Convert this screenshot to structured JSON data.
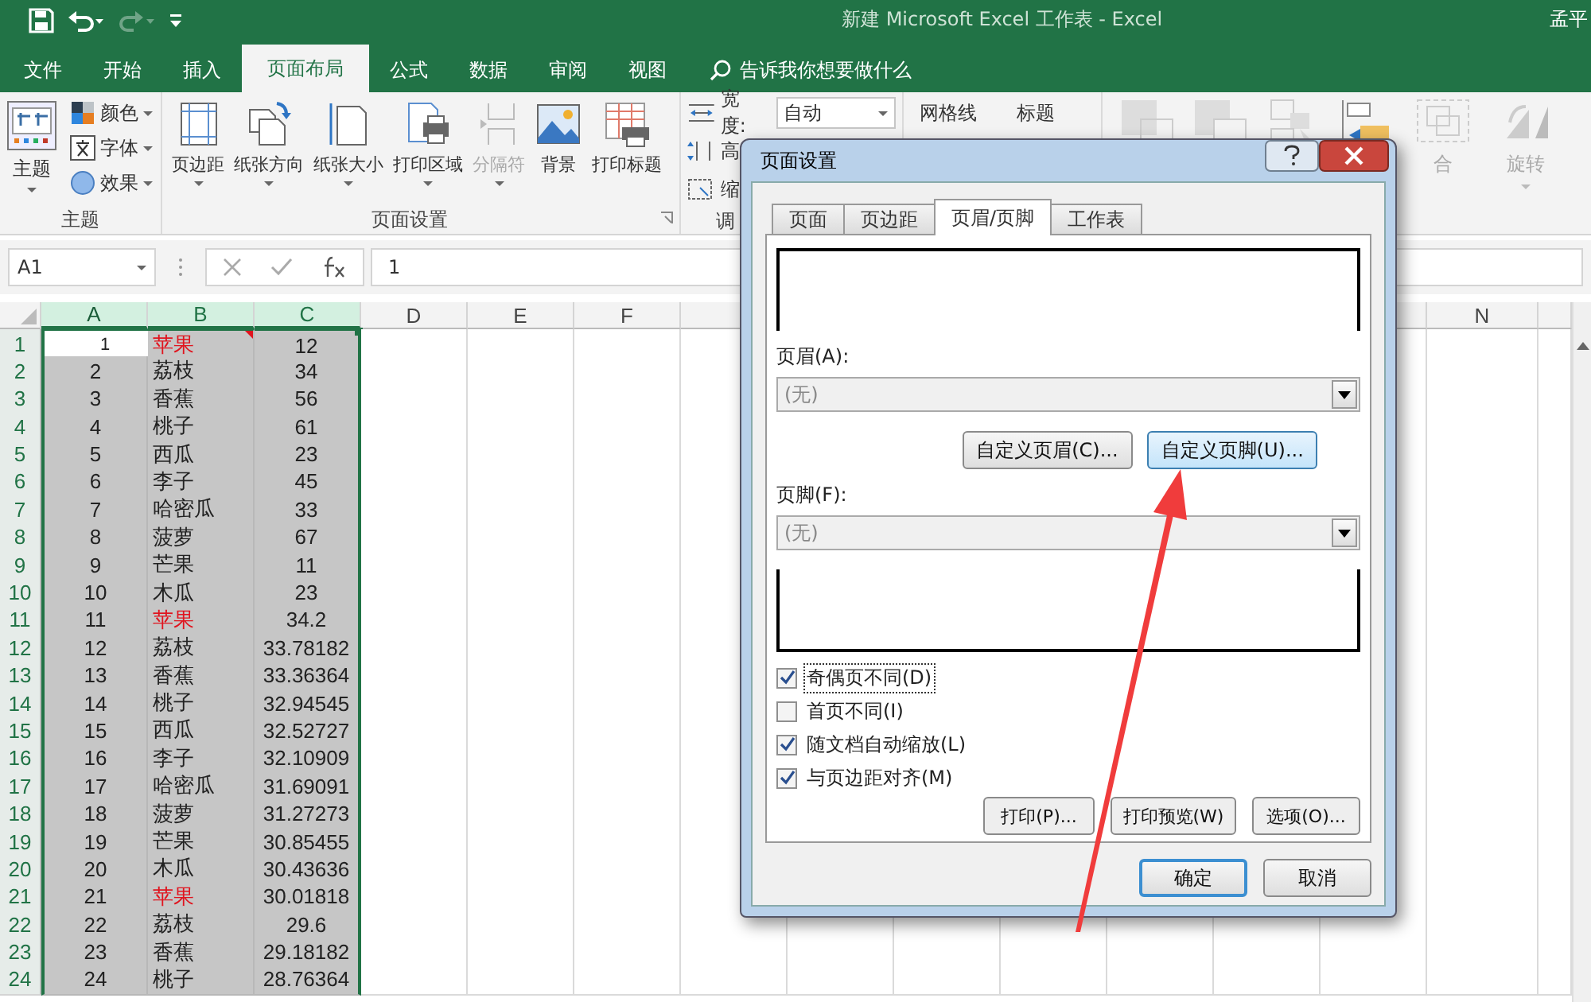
{
  "window": {
    "title": "新建 Microsoft Excel 工作表  -  Excel",
    "user": "孟平",
    "redo_disabled": true
  },
  "tabs": [
    {
      "label": "文件",
      "selected": false
    },
    {
      "label": "开始",
      "selected": false
    },
    {
      "label": "插入",
      "selected": false
    },
    {
      "label": "页面布局",
      "selected": true
    },
    {
      "label": "公式",
      "selected": false
    },
    {
      "label": "数据",
      "selected": false
    },
    {
      "label": "审阅",
      "selected": false
    },
    {
      "label": "视图",
      "selected": false
    }
  ],
  "tell_me": {
    "placeholder": "告诉我你想要做什么"
  },
  "ribbon": {
    "theme_group": {
      "label": "主题",
      "main": {
        "label": "主题",
        "has_menu": true
      },
      "items": [
        {
          "label": "颜色",
          "has_menu": true
        },
        {
          "label": "字体",
          "has_menu": true
        },
        {
          "label": "效果",
          "has_menu": true
        }
      ]
    },
    "page_setup_group": {
      "label": "页面设置",
      "buttons": [
        {
          "label": "页边距",
          "has_menu": true,
          "disabled": false
        },
        {
          "label": "纸张方向",
          "has_menu": true,
          "disabled": false
        },
        {
          "label": "纸张大小",
          "has_menu": true,
          "disabled": false
        },
        {
          "label": "打印区域",
          "has_menu": true,
          "disabled": false
        },
        {
          "label": "分隔符",
          "has_menu": true,
          "disabled": true
        },
        {
          "label": "背景",
          "has_menu": false,
          "disabled": false
        },
        {
          "label": "打印标题",
          "has_menu": false,
          "disabled": false
        }
      ]
    },
    "scale_group": {
      "width_label": "宽度:",
      "width_value": "自动",
      "height_label": "高",
      "scale_label": "缩",
      "label": "调"
    },
    "sheet_options": {
      "gridlines_label": "网格线",
      "headings_label": "标题"
    },
    "arrange_group": {
      "partial_label": "合",
      "rotate_label": "旋转"
    }
  },
  "formula_bar": {
    "name_box": "A1",
    "value": "1"
  },
  "sheet": {
    "columns": [
      {
        "label": "A",
        "selected": true,
        "active": true
      },
      {
        "label": "B",
        "selected": true,
        "active": false
      },
      {
        "label": "C",
        "selected": true,
        "active": false
      },
      {
        "label": "D",
        "selected": false,
        "active": false
      },
      {
        "label": "E",
        "selected": false,
        "active": false
      },
      {
        "label": "F",
        "selected": false,
        "active": false
      }
    ],
    "far_column": "N",
    "rows": [
      {
        "number": "1",
        "selected": true,
        "active": true,
        "cells": [
          "1",
          "苹果",
          "12"
        ],
        "color": "#e0141e",
        "comment": true
      },
      {
        "number": "2",
        "selected": true,
        "active": false,
        "cells": [
          "2",
          "荔枝",
          "34"
        ],
        "color": "#222222",
        "comment": false
      },
      {
        "number": "3",
        "selected": true,
        "active": false,
        "cells": [
          "3",
          "香蕉",
          "56"
        ],
        "color": "#222222",
        "comment": false
      },
      {
        "number": "4",
        "selected": true,
        "active": false,
        "cells": [
          "4",
          "桃子",
          "61"
        ],
        "color": "#222222",
        "comment": false
      },
      {
        "number": "5",
        "selected": true,
        "active": false,
        "cells": [
          "5",
          "西瓜",
          "23"
        ],
        "color": "#222222",
        "comment": false
      },
      {
        "number": "6",
        "selected": true,
        "active": false,
        "cells": [
          "6",
          "李子",
          "45"
        ],
        "color": "#222222",
        "comment": false
      },
      {
        "number": "7",
        "selected": true,
        "active": false,
        "cells": [
          "7",
          "哈密瓜",
          "33"
        ],
        "color": "#222222",
        "comment": false
      },
      {
        "number": "8",
        "selected": true,
        "active": false,
        "cells": [
          "8",
          "菠萝",
          "67"
        ],
        "color": "#222222",
        "comment": false
      },
      {
        "number": "9",
        "selected": true,
        "active": false,
        "cells": [
          "9",
          "芒果",
          "11"
        ],
        "color": "#222222",
        "comment": false
      },
      {
        "number": "10",
        "selected": true,
        "active": false,
        "cells": [
          "10",
          "木瓜",
          "23"
        ],
        "color": "#222222",
        "comment": false
      },
      {
        "number": "11",
        "selected": true,
        "active": false,
        "cells": [
          "11",
          "苹果",
          "34.2"
        ],
        "color": "#e0141e",
        "comment": false
      },
      {
        "number": "12",
        "selected": true,
        "active": false,
        "cells": [
          "12",
          "荔枝",
          "33.78182"
        ],
        "color": "#222222",
        "comment": false
      },
      {
        "number": "13",
        "selected": true,
        "active": false,
        "cells": [
          "13",
          "香蕉",
          "33.36364"
        ],
        "color": "#222222",
        "comment": false
      },
      {
        "number": "14",
        "selected": true,
        "active": false,
        "cells": [
          "14",
          "桃子",
          "32.94545"
        ],
        "color": "#222222",
        "comment": false
      },
      {
        "number": "15",
        "selected": true,
        "active": false,
        "cells": [
          "15",
          "西瓜",
          "32.52727"
        ],
        "color": "#222222",
        "comment": false
      },
      {
        "number": "16",
        "selected": true,
        "active": false,
        "cells": [
          "16",
          "李子",
          "32.10909"
        ],
        "color": "#222222",
        "comment": false
      },
      {
        "number": "17",
        "selected": true,
        "active": false,
        "cells": [
          "17",
          "哈密瓜",
          "31.69091"
        ],
        "color": "#222222",
        "comment": false
      },
      {
        "number": "18",
        "selected": true,
        "active": false,
        "cells": [
          "18",
          "菠萝",
          "31.27273"
        ],
        "color": "#222222",
        "comment": false
      },
      {
        "number": "19",
        "selected": true,
        "active": false,
        "cells": [
          "19",
          "芒果",
          "30.85455"
        ],
        "color": "#222222",
        "comment": false
      },
      {
        "number": "20",
        "selected": true,
        "active": false,
        "cells": [
          "20",
          "木瓜",
          "30.43636"
        ],
        "color": "#222222",
        "comment": false
      },
      {
        "number": "21",
        "selected": true,
        "active": false,
        "cells": [
          "21",
          "苹果",
          "30.01818"
        ],
        "color": "#e0141e",
        "comment": false
      },
      {
        "number": "22",
        "selected": true,
        "active": false,
        "cells": [
          "22",
          "荔枝",
          "29.6"
        ],
        "color": "#222222",
        "comment": false
      },
      {
        "number": "23",
        "selected": true,
        "active": false,
        "cells": [
          "23",
          "香蕉",
          "29.18182"
        ],
        "color": "#222222",
        "comment": false
      },
      {
        "number": "24",
        "selected": true,
        "active": false,
        "cells": [
          "24",
          "桃子",
          "28.76364"
        ],
        "color": "#222222",
        "comment": false
      }
    ]
  },
  "dialog": {
    "title": "页面设置",
    "tabs": [
      {
        "label": "页面",
        "selected": false
      },
      {
        "label": "页边距",
        "selected": false
      },
      {
        "label": "页眉/页脚",
        "selected": true
      },
      {
        "label": "工作表",
        "selected": false
      }
    ],
    "header_label": "页眉(A):",
    "header_value": "(无)",
    "custom_buttons": [
      {
        "label": "自定义页眉(C)...",
        "highlighted": false
      },
      {
        "label": "自定义页脚(U)...",
        "highlighted": true
      }
    ],
    "footer_label": "页脚(F):",
    "footer_value": "(无)",
    "options": [
      {
        "label": "奇偶页不同(D)",
        "checked": true,
        "focused": true
      },
      {
        "label": "首页不同(I)",
        "checked": false,
        "focused": false
      },
      {
        "label": "随文档自动缩放(L)",
        "checked": true,
        "focused": false
      },
      {
        "label": "与页边距对齐(M)",
        "checked": true,
        "focused": false
      }
    ],
    "actions": [
      "打印(P)...",
      "打印预览(W)",
      "选项(O)..."
    ],
    "footer_buttons": [
      {
        "label": "确定",
        "default": true
      },
      {
        "label": "取消",
        "default": false
      }
    ]
  }
}
